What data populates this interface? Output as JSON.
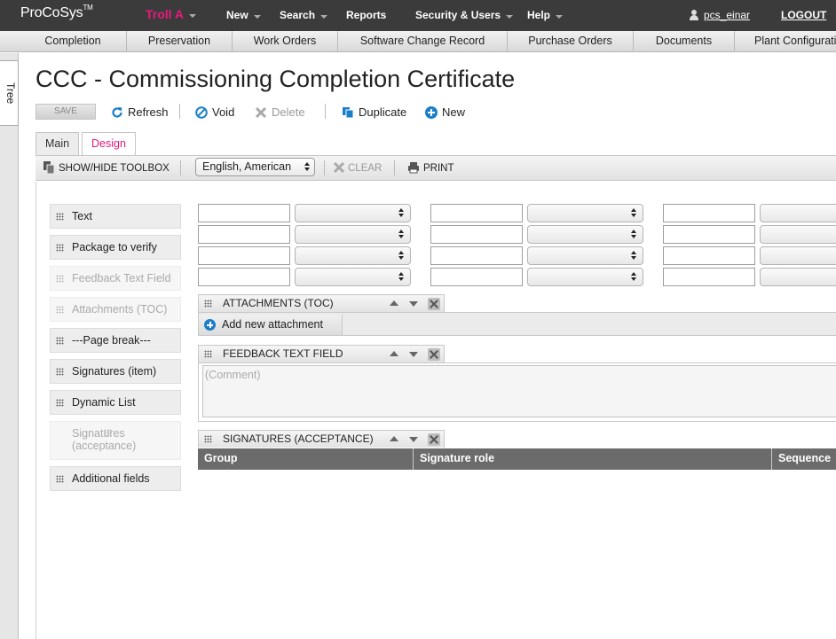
{
  "topbar": {
    "logo": "ProCoSys",
    "logo_tm": "TM",
    "project": "Troll A",
    "nav": [
      "New",
      "Search",
      "Reports",
      "Security & Users",
      "Help"
    ],
    "username": "pcs_einar",
    "logout": "LOGOUT"
  },
  "menubar": [
    "Completion",
    "Preservation",
    "Work Orders",
    "Software Change Record",
    "Purchase Orders",
    "Documents",
    "Plant Configurati"
  ],
  "tree_tab": "Tree",
  "page_title": "CCC - Commissioning Completion Certificate",
  "toolbar": {
    "save": "SAVE",
    "refresh": "Refresh",
    "void": "Void",
    "delete": "Delete",
    "duplicate": "Duplicate",
    "new": "New"
  },
  "tabs": [
    "Main",
    "Design"
  ],
  "design_toolbar": {
    "toggle": "SHOW/HIDE TOOLBOX",
    "language": "English, American",
    "clear": "CLEAR",
    "print": "PRINT"
  },
  "toolbox": [
    {
      "label": "Text",
      "disabled": false
    },
    {
      "label": "Package to verify",
      "disabled": false
    },
    {
      "label": "Feedback Text Field",
      "disabled": true
    },
    {
      "label": "Attachments (TOC)",
      "disabled": true
    },
    {
      "label": "---Page break---",
      "disabled": false
    },
    {
      "label": "Signatures (item)",
      "disabled": false
    },
    {
      "label": "Dynamic List",
      "disabled": false
    },
    {
      "label": "Signatures (acceptance)",
      "disabled": true
    },
    {
      "label": "Additional fields",
      "disabled": false
    }
  ],
  "sections": {
    "attachments": {
      "title": "ATTACHMENTS (TOC)",
      "add_label": "Add new attachment"
    },
    "feedback": {
      "title": "FEEDBACK TEXT FIELD",
      "placeholder": "(Comment)"
    },
    "signatures": {
      "title": "SIGNATURES (ACCEPTANCE)",
      "columns": [
        "Group",
        "Signature role",
        "Sequence"
      ]
    }
  },
  "colors": {
    "accent": "#e8187a",
    "topbar": "#3b3b3b",
    "table_header": "#6b6b6b",
    "link_blue": "#1a7fc8"
  }
}
